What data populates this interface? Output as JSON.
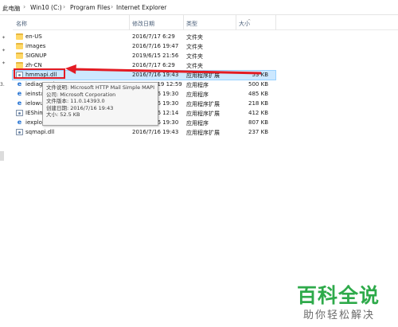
{
  "breadcrumb": [
    "此电脑",
    "Win10 (C:)",
    "Program Files",
    "Internet Explorer"
  ],
  "breadcrumb_separator": "›",
  "columns": {
    "name": "名称",
    "date": "修改日期",
    "type": "类型",
    "size": "大小"
  },
  "files": [
    {
      "name": "en-US",
      "date": "2016/7/17 6:29",
      "type": "文件夹",
      "size": "",
      "icon": "folder-icon"
    },
    {
      "name": "images",
      "date": "2016/7/16 19:47",
      "type": "文件夹",
      "size": "",
      "icon": "folder-icon"
    },
    {
      "name": "SIGNUP",
      "date": "2019/6/15 21:56",
      "type": "文件夹",
      "size": "",
      "icon": "folder-icon"
    },
    {
      "name": "zh-CN",
      "date": "2016/7/17 6:29",
      "type": "文件夹",
      "size": "",
      "icon": "folder-icon"
    },
    {
      "name": "hmmapi.dll",
      "date": "2016/7/16 19:43",
      "type": "应用程序扩展",
      "size": "53 KB",
      "icon": "dll-file-icon",
      "selected": true
    },
    {
      "name": "iediagcmd",
      "date": "2016/12/19 12:59",
      "type": "应用程序",
      "size": "500 KB",
      "icon": "ie-exe-icon"
    },
    {
      "name": "ieinsta",
      "date": "2016/7/16 19:30",
      "type": "应用程序",
      "size": "485 KB",
      "icon": "ie-exe-icon"
    },
    {
      "name": "ielowu",
      "date": "2016/7/16 19:30",
      "type": "应用程序扩展",
      "size": "218 KB",
      "icon": "ie-exe-icon"
    },
    {
      "name": "IEShim",
      "date": "2016/7/16 12:14",
      "type": "应用程序扩展",
      "size": "412 KB",
      "icon": "dll-file-icon"
    },
    {
      "name": "iexplo",
      "date": "2016/7/16 19:30",
      "type": "应用程序",
      "size": "807 KB",
      "icon": "ie-exe-icon"
    },
    {
      "name": "sqmapi.dll",
      "date": "2016/7/16 19:43",
      "type": "应用程序扩展",
      "size": "237 KB",
      "icon": "dll-file-icon"
    }
  ],
  "tooltip": {
    "description": "文件说明: Microsoft HTTP Mail Simple MAPI",
    "company": "公司: Microsoft Corporation",
    "version": "文件版本: 11.0.14393.0",
    "created": "创建日期: 2016/7/16 19:43",
    "size": "大小: 52.5 KB"
  },
  "nav_hint": "3.",
  "annotation": {
    "color": "#e31b23"
  },
  "watermark": {
    "title": "百科全说",
    "subtitle": "助你轻松解决",
    "color": "#2eaa4a"
  },
  "colors": {
    "selection_bg": "#cce8ff",
    "folder": "#ffd867",
    "header_text": "#4c607a"
  }
}
